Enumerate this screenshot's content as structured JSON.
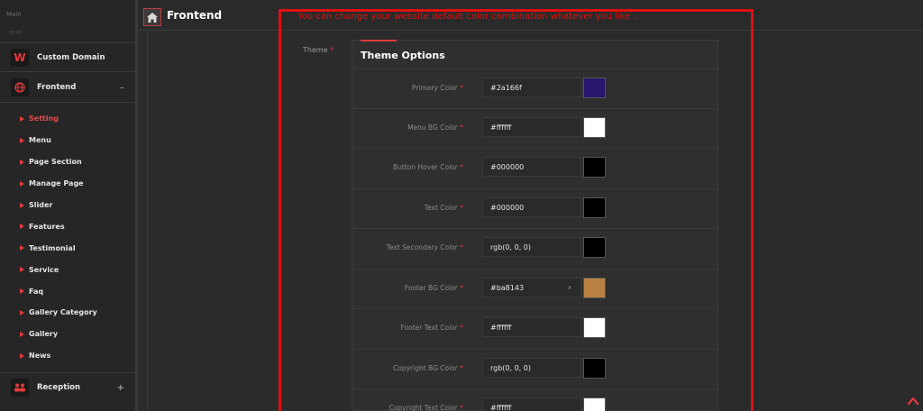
{
  "sidebar": {
    "section_label": "Main",
    "section_sub": "00:00",
    "items": [
      {
        "label": "Custom Domain",
        "icon": "w-logo-icon",
        "toggle": ""
      },
      {
        "label": "Frontend",
        "icon": "globe-icon",
        "toggle": "–"
      },
      {
        "label": "Reception",
        "icon": "people-icon",
        "toggle": "+"
      }
    ],
    "submenu": [
      {
        "label": "Setting",
        "active": true
      },
      {
        "label": "Menu"
      },
      {
        "label": "Page Section"
      },
      {
        "label": "Manage Page"
      },
      {
        "label": "Slider"
      },
      {
        "label": "Features"
      },
      {
        "label": "Testimonial"
      },
      {
        "label": "Service"
      },
      {
        "label": "Faq"
      },
      {
        "label": "Gallery Category"
      },
      {
        "label": "Gallery"
      },
      {
        "label": "News"
      }
    ]
  },
  "header": {
    "title": "Frontend",
    "home_icon": "home-icon"
  },
  "form": {
    "theme_label": "Theme",
    "required_mark": "*",
    "panel_title": "Theme Options",
    "options": [
      {
        "label": "Primary Color",
        "value": "#2a166f",
        "swatch": "#2a166f"
      },
      {
        "label": "Menu BG Color",
        "value": "#ffffff",
        "swatch": "#ffffff"
      },
      {
        "label": "Button Hover Color",
        "value": "#000000",
        "swatch": "#000000"
      },
      {
        "label": "Text Color",
        "value": "#000000",
        "swatch": "#000000"
      },
      {
        "label": "Text Secondary Color",
        "value": "rgb(0, 0, 0)",
        "swatch": "#000000"
      },
      {
        "label": "Footer BG Color",
        "value": "#ba8143",
        "swatch": "#ba8143",
        "clear": "x"
      },
      {
        "label": "Footer Text Color",
        "value": "#ffffff",
        "swatch": "#ffffff"
      },
      {
        "label": "Copyright BG Color",
        "value": "rgb(0, 0, 0)",
        "swatch": "#000000"
      },
      {
        "label": "Copyright Text Color",
        "value": "#ffffff",
        "swatch": "#ffffff"
      }
    ]
  },
  "annotation": {
    "text": "You can change your website default color combination whatever you like .."
  },
  "colors": {
    "accent": "#e23b3b",
    "annotation": "#e01010"
  }
}
